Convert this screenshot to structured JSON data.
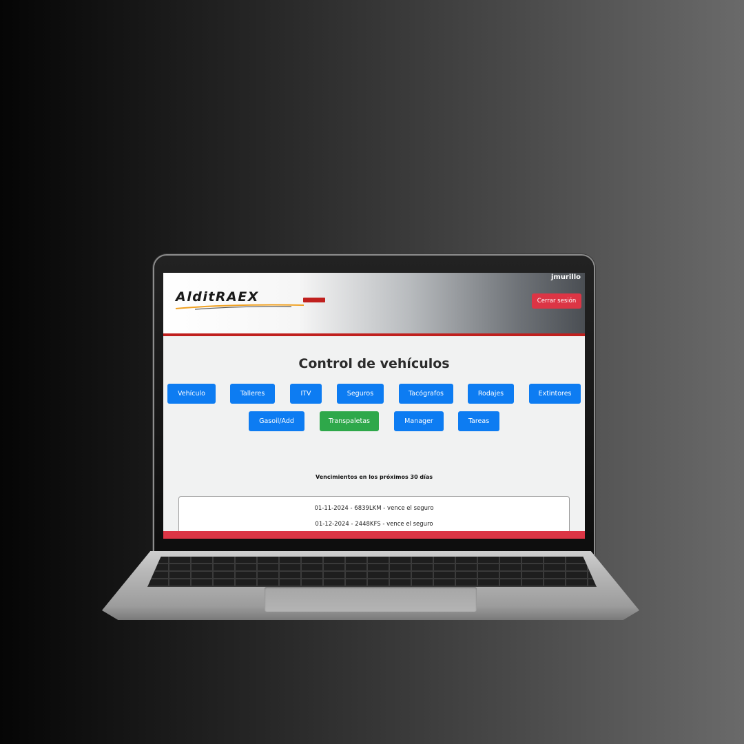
{
  "header": {
    "logo_text": "AlditRAEX",
    "username": "jmurillo",
    "logout_label": "Cerrar sesión"
  },
  "main": {
    "title": "Control de vehículos",
    "nav_row1": [
      "Vehículo",
      "Talleres",
      "ITV",
      "Seguros",
      "Tacógrafos",
      "Rodajes",
      "Extintores"
    ],
    "nav_row2": [
      "Gasoil/Add",
      "Transpaletas",
      "Manager",
      "Tareas"
    ],
    "alerts_label": "Vencimientos en los próximos 30 días",
    "alerts": [
      "01-11-2024 - 6839LKM - vence el seguro",
      "01-12-2024 - 2448KFS - vence el seguro"
    ]
  },
  "colors": {
    "primary": "#0d7cf2",
    "success": "#2ea84a",
    "danger": "#dc3545",
    "brand_red": "#c0201e"
  }
}
